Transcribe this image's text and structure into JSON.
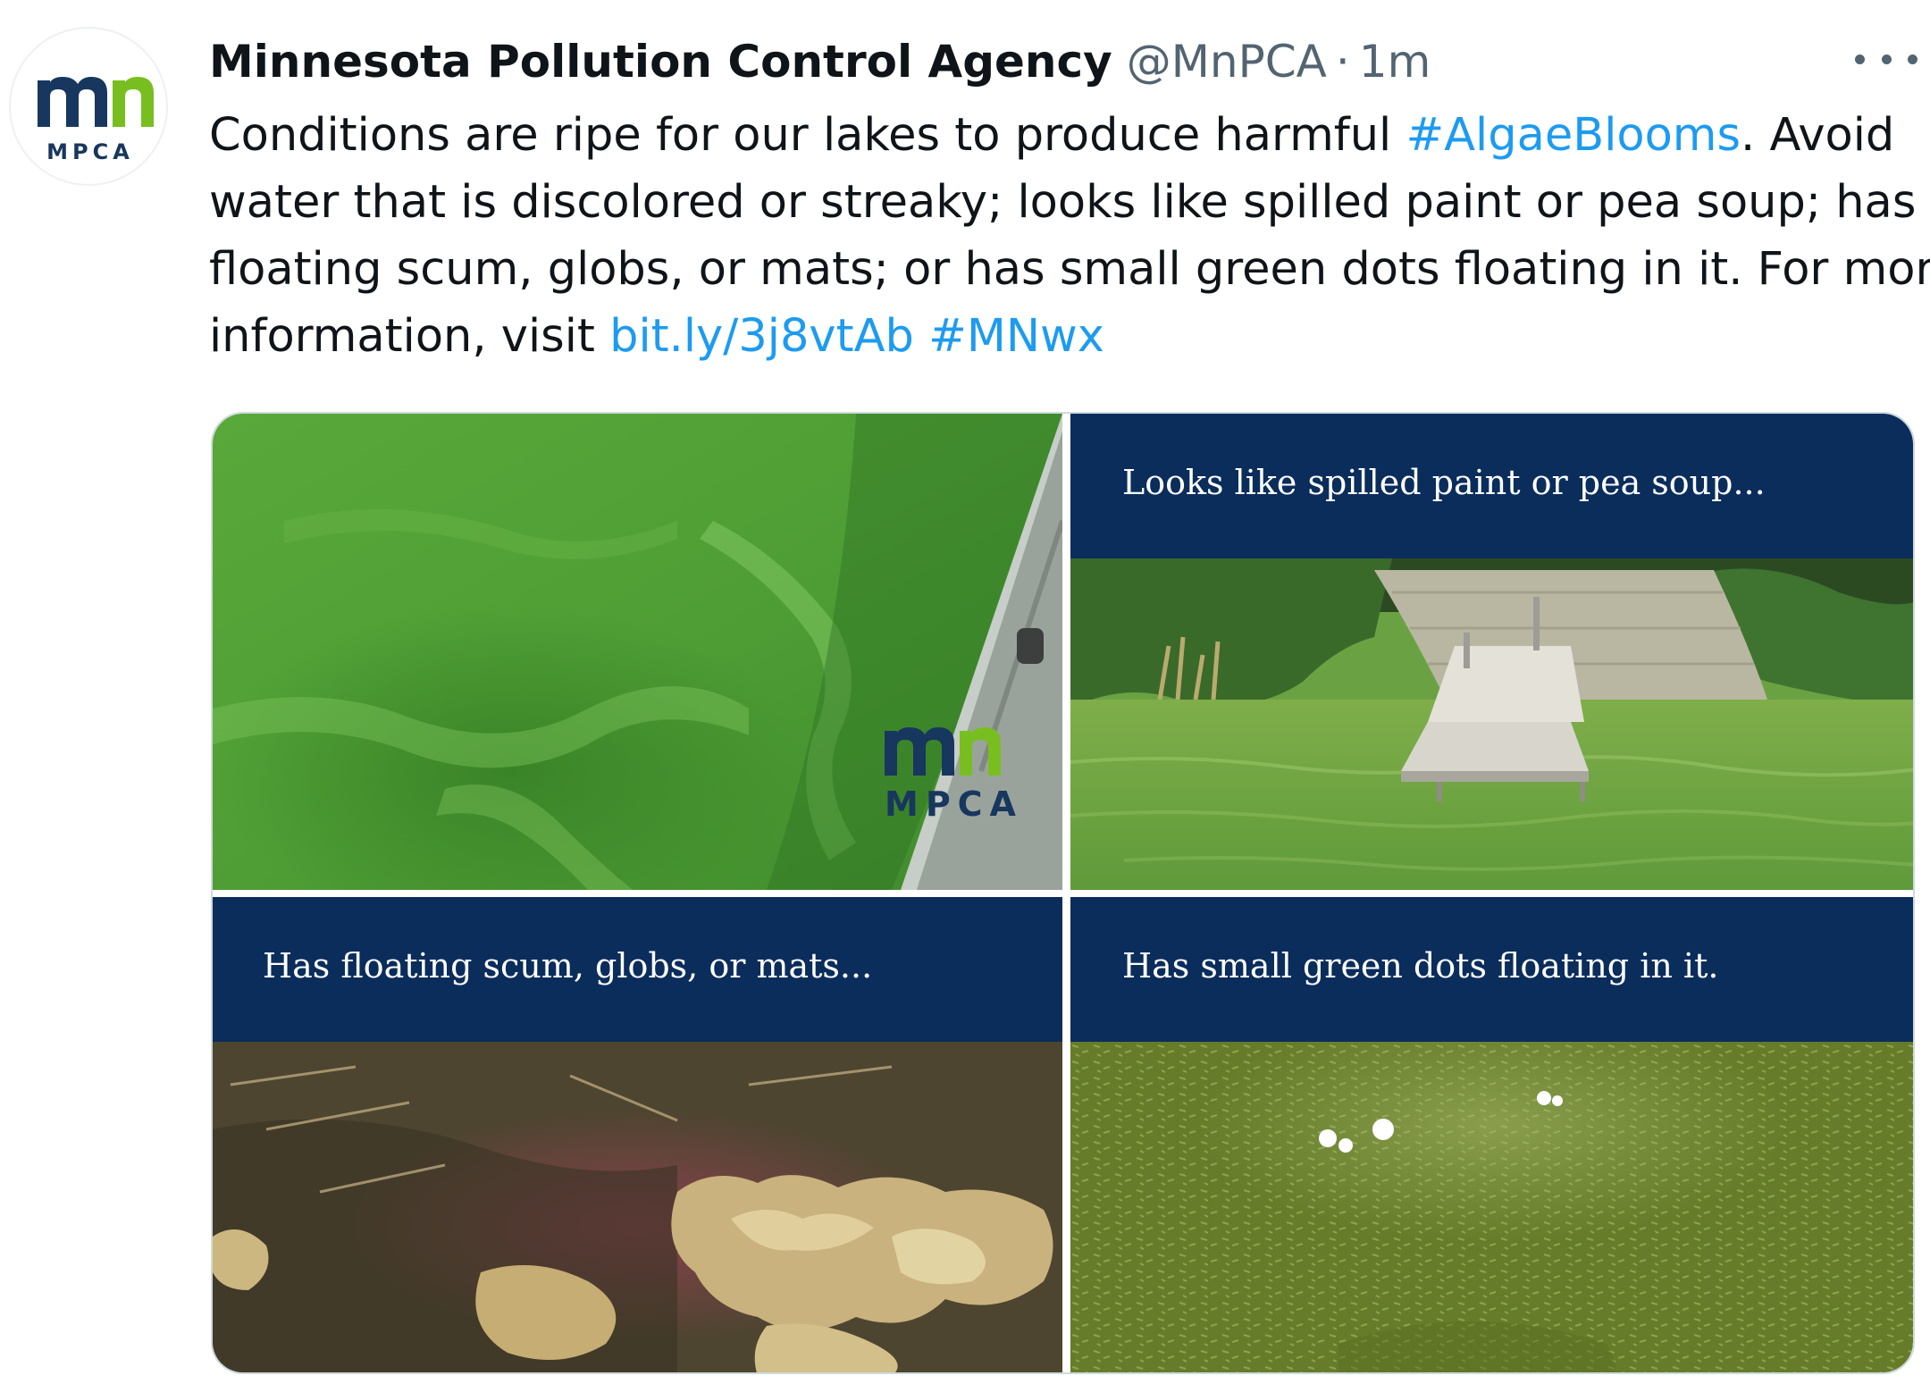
{
  "account": {
    "display_name": "Minnesota Pollution Control Agency",
    "handle": "@MnPCA",
    "separator": "·",
    "timestamp": "1m",
    "avatar_wordmark": "MPCA",
    "avatar_icon": "mpca-mn-logo"
  },
  "tweet": {
    "line1_prefix": "Conditions are ripe for our lakes to produce harmful ",
    "hashtag_algae": "#AlgaeBlooms",
    "line1_suffix": ". Avoid",
    "line2": "water that is discolored or streaky; looks like spilled paint or pea soup; has",
    "line3": "floating scum, globs, or mats; or has small green dots floating in it. For more",
    "line4_prefix": "information, visit ",
    "link": "bit.ly/3j8vtAb",
    "hashtag_mnwx": "#MNwx"
  },
  "media": {
    "photo1_watermark": "MPCA",
    "photo2_caption": "Looks like spilled paint or pea soup...",
    "photo3_caption": "Has floating scum, globs, or mats...",
    "photo4_caption": "Has small green dots floating in it."
  },
  "icons": {
    "more": "more-options-icon"
  },
  "colors": {
    "link": "#1d9bf0",
    "secondary_text": "#536471",
    "caption_band": "#0b2d5c",
    "mpca_navy": "#17375e",
    "mpca_green": "#78be20"
  }
}
